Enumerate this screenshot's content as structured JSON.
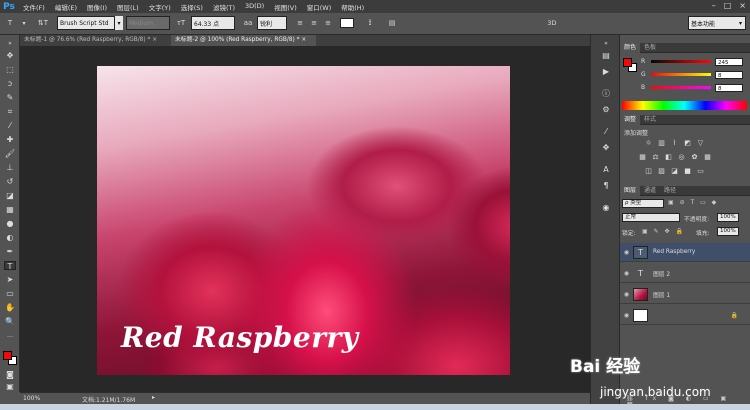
{
  "app": {
    "logo": "Ps"
  },
  "menu": [
    "文件(F)",
    "编辑(E)",
    "图像(I)",
    "图层(L)",
    "文字(Y)",
    "选择(S)",
    "滤镜(T)",
    "3D(D)",
    "视图(V)",
    "窗口(W)",
    "帮助(H)"
  ],
  "options": {
    "font_family": "Brush Script Std",
    "font_style": "Medium",
    "font_size": "64.33 点",
    "antialias": "锐利",
    "mode_3d": "3D",
    "workspace": "基本功能"
  },
  "tabs": [
    {
      "label": "未标题-1 @ 76.6% (Red Raspberry, RGB/8) *",
      "close": "×"
    },
    {
      "label": "未标题-2 @ 100% (Red Raspberry, RGB/8) *",
      "close": "×"
    }
  ],
  "document": {
    "text": "Red Raspberry"
  },
  "status": {
    "zoom": "100%",
    "doc_size": "文档:1.21M/1.76M"
  },
  "color_panel": {
    "tabs": [
      "颜色",
      "色板"
    ],
    "channels": [
      {
        "label": "R",
        "value": "245"
      },
      {
        "label": "G",
        "value": "8"
      },
      {
        "label": "B",
        "value": "8"
      }
    ]
  },
  "adjust_panel": {
    "tabs": [
      "调整",
      "样式"
    ],
    "title": "添加调整"
  },
  "layers_panel": {
    "tabs": [
      "图层",
      "通道",
      "路径"
    ],
    "filter": "ρ 类型",
    "blend_mode": "正常",
    "opacity_label": "不透明度:",
    "opacity": "100%",
    "lock_label": "锁定:",
    "fill_label": "填充:",
    "fill": "100%",
    "layers": [
      {
        "name": "Red Raspberry",
        "kind": "text",
        "selected": true
      },
      {
        "name": "图层 2",
        "kind": "text",
        "selected": false
      },
      {
        "name": "图层 1",
        "kind": "image",
        "selected": false
      },
      {
        "name": "",
        "kind": "background",
        "selected": false
      }
    ]
  },
  "watermark": {
    "brand": "Bai 经验",
    "url": "jingyan.baidu.com"
  },
  "colors": {
    "accent": "#31a8ff",
    "foreground": "#f50808",
    "background": "#ffffff"
  }
}
